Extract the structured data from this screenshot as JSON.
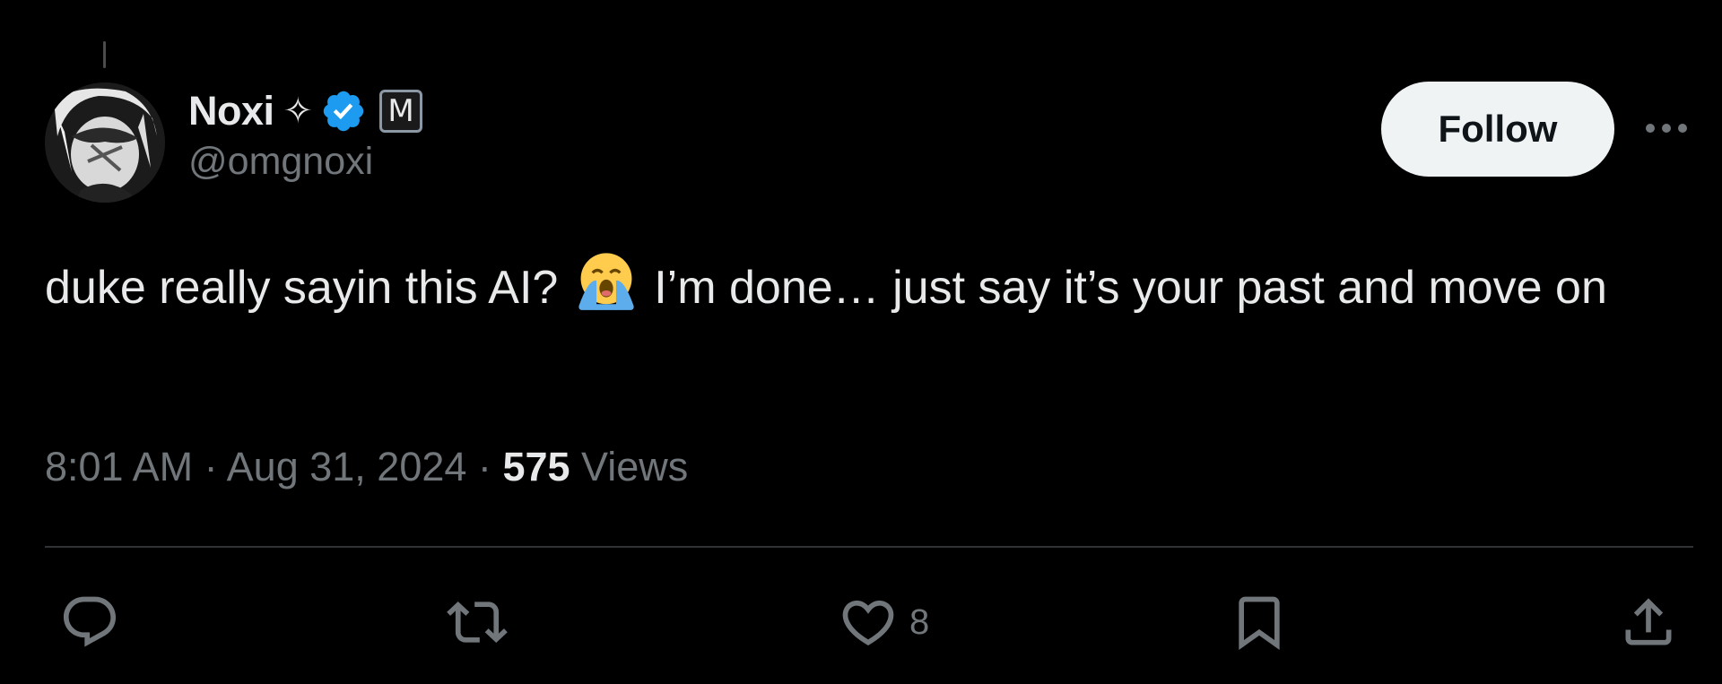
{
  "author": {
    "display_name": "Noxi",
    "name_emoji": "✧",
    "badge_letter": "M",
    "handle": "@omgnoxi",
    "verified": true,
    "verified_color": "#1d9bf0"
  },
  "follow_button": {
    "label": "Follow"
  },
  "tweet": {
    "text_before_emoji": "duke really sayin this AI?",
    "emoji": "loudly-crying-face",
    "text_after_emoji": "I’m done… just say it’s your past and move on",
    "time": "8:01 AM",
    "separator": "·",
    "date": "Aug 31, 2024",
    "views_count": "575",
    "views_label": "Views"
  },
  "actions": {
    "reply": {
      "icon": "reply-icon"
    },
    "repost": {
      "icon": "repost-icon"
    },
    "like": {
      "icon": "heart-icon",
      "count": "8"
    },
    "bookmark": {
      "icon": "bookmark-icon"
    },
    "share": {
      "icon": "share-icon"
    }
  },
  "colors": {
    "background": "#000000",
    "text_primary": "#e7e9ea",
    "text_secondary": "#71767b",
    "divider": "#2f3336",
    "follow_bg": "#eff3f4"
  }
}
